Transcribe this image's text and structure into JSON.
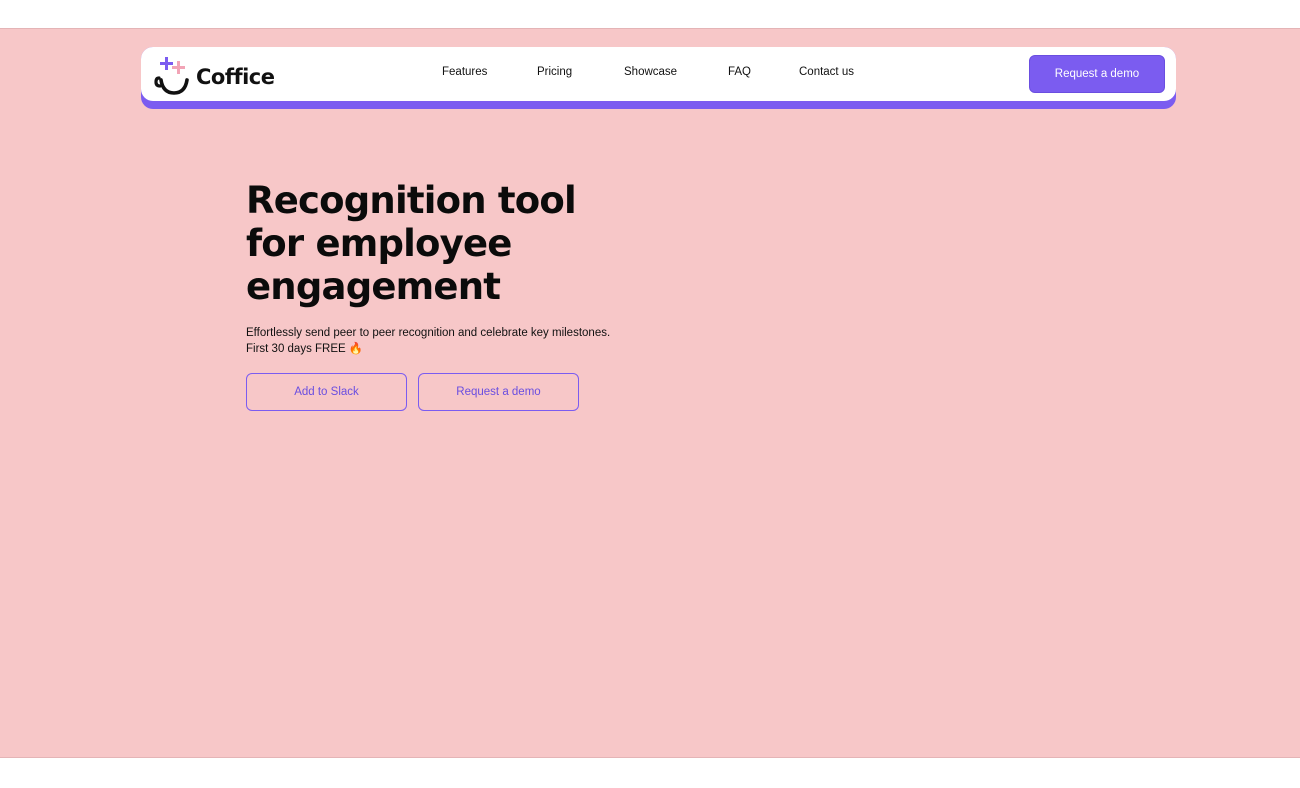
{
  "brand": {
    "name": "Coffice",
    "logo_icon": "smiley-cup-plus-icon",
    "colors": {
      "accent": "#7b5cf0",
      "hero_background": "#f7c7c8",
      "logo_pink": "#f2a4b6",
      "text": "#111111"
    }
  },
  "nav": {
    "links": [
      {
        "label": "Features"
      },
      {
        "label": "Pricing"
      },
      {
        "label": "Showcase"
      },
      {
        "label": "FAQ"
      },
      {
        "label": "Contact us"
      }
    ],
    "cta_label": "Request a demo"
  },
  "hero": {
    "title_lines": [
      "Recognition tool",
      "for employee",
      "engagement"
    ],
    "subtitle_lines": [
      "Effortlessly send peer to peer recognition and celebrate key milestones.",
      "First 30 days FREE 🔥"
    ],
    "primary_button": "Add to Slack",
    "secondary_button": "Request a demo"
  }
}
